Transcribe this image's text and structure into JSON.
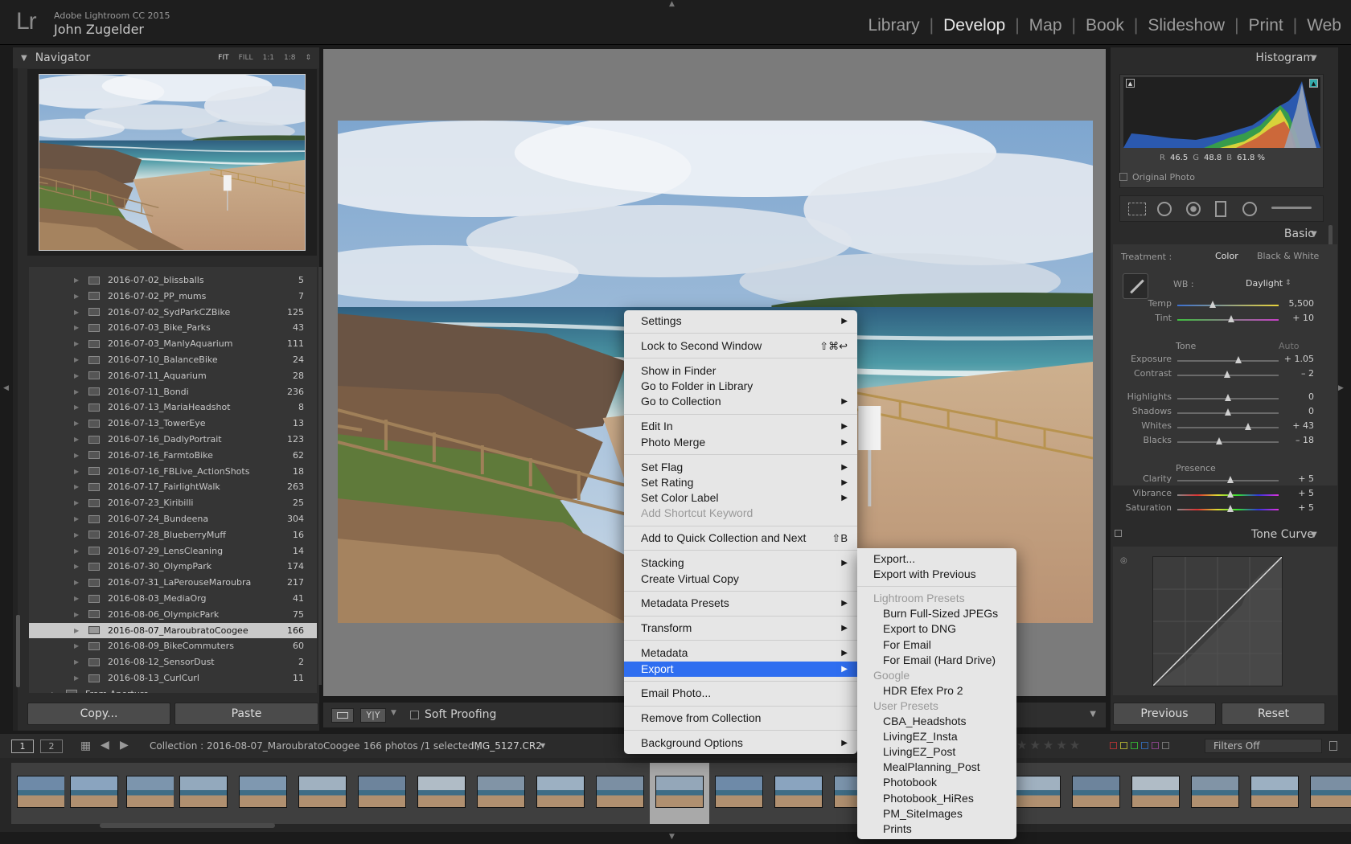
{
  "app": {
    "logo": "Lr",
    "name": "Adobe Lightroom CC 2015",
    "user": "John Zugelder"
  },
  "modules": [
    {
      "label": "Library",
      "active": false
    },
    {
      "label": "Develop",
      "active": true
    },
    {
      "label": "Map",
      "active": false
    },
    {
      "label": "Book",
      "active": false
    },
    {
      "label": "Slideshow",
      "active": false
    },
    {
      "label": "Print",
      "active": false
    },
    {
      "label": "Web",
      "active": false
    }
  ],
  "navigator": {
    "title": "Navigator",
    "zoom": [
      "FIT",
      "FILL",
      "1:1",
      "1:8"
    ]
  },
  "folders": [
    {
      "name": "2016-07-02_blissballs",
      "count": "5"
    },
    {
      "name": "2016-07-02_PP_mums",
      "count": "7"
    },
    {
      "name": "2016-07-02_SydParkCZBike",
      "count": "125"
    },
    {
      "name": "2016-07-03_Bike_Parks",
      "count": "43"
    },
    {
      "name": "2016-07-03_ManlyAquarium",
      "count": "111"
    },
    {
      "name": "2016-07-10_BalanceBike",
      "count": "24"
    },
    {
      "name": "2016-07-11_Aquarium",
      "count": "28"
    },
    {
      "name": "2016-07-11_Bondi",
      "count": "236"
    },
    {
      "name": "2016-07-13_MariaHeadshot",
      "count": "8"
    },
    {
      "name": "2016-07-13_TowerEye",
      "count": "13"
    },
    {
      "name": "2016-07-16_DadlyPortrait",
      "count": "123"
    },
    {
      "name": "2016-07-16_FarmtoBike",
      "count": "62"
    },
    {
      "name": "2016-07-16_FBLive_ActionShots",
      "count": "18"
    },
    {
      "name": "2016-07-17_FairlightWalk",
      "count": "263"
    },
    {
      "name": "2016-07-23_Kiribilli",
      "count": "25"
    },
    {
      "name": "2016-07-24_Bundeena",
      "count": "304"
    },
    {
      "name": "2016-07-28_BlueberryMuff",
      "count": "16"
    },
    {
      "name": "2016-07-29_LensCleaning",
      "count": "14"
    },
    {
      "name": "2016-07-30_OlympPark",
      "count": "174"
    },
    {
      "name": "2016-07-31_LaPerouseMaroubra",
      "count": "217"
    },
    {
      "name": "2016-08-03_MediaOrg",
      "count": "41"
    },
    {
      "name": "2016-08-06_OlympicPark",
      "count": "75"
    },
    {
      "name": "2016-08-07_MaroubratoCoogee",
      "count": "166",
      "selected": true
    },
    {
      "name": "2016-08-09_BikeCommuters",
      "count": "60"
    },
    {
      "name": "2016-08-12_SensorDust",
      "count": "2"
    },
    {
      "name": "2016-08-13_CurlCurl",
      "count": "11"
    }
  ],
  "folders_extra": "From Aperture",
  "left_buttons": {
    "copy": "Copy...",
    "paste": "Paste"
  },
  "toolbar": {
    "soft_proofing": "Soft Proofing",
    "yy": "Y|Y"
  },
  "right": {
    "histogram": "Histogram",
    "rgb": {
      "r_label": "R",
      "r": "46.5",
      "g_label": "G",
      "g": "48.8",
      "b_label": "B",
      "b": "61.8 %"
    },
    "original_photo": "Original Photo",
    "basic": "Basic",
    "treatment_label": "Treatment :",
    "treatment_color": "Color",
    "treatment_bw": "Black & White",
    "wb_label": "WB :",
    "wb_value": "Daylight",
    "tone": "Tone",
    "auto": "Auto",
    "presence": "Presence",
    "tone_curve": "Tone Curve",
    "previous": "Previous",
    "reset": "Reset",
    "sliders": [
      {
        "label": "Temp",
        "value": "5,500",
        "pos": 0.35,
        "color": "temp"
      },
      {
        "label": "Tint",
        "value": "+ 10",
        "pos": 0.53,
        "color": "tint"
      },
      {
        "label": "Exposure",
        "value": "+ 1.05",
        "pos": 0.6,
        "color": "gray"
      },
      {
        "label": "Contrast",
        "value": "– 2",
        "pos": 0.49,
        "color": "gray"
      },
      {
        "label": "Highlights",
        "value": "0",
        "pos": 0.5,
        "color": "gray"
      },
      {
        "label": "Shadows",
        "value": "0",
        "pos": 0.5,
        "color": "gray"
      },
      {
        "label": "Whites",
        "value": "+ 43",
        "pos": 0.7,
        "color": "gray"
      },
      {
        "label": "Blacks",
        "value": "– 18",
        "pos": 0.41,
        "color": "gray"
      },
      {
        "label": "Clarity",
        "value": "+ 5",
        "pos": 0.52,
        "color": "gray"
      },
      {
        "label": "Vibrance",
        "value": "+ 5",
        "pos": 0.52,
        "color": "sat"
      },
      {
        "label": "Saturation",
        "value": "+ 5",
        "pos": 0.52,
        "color": "sat"
      }
    ]
  },
  "filmstrip": {
    "page1": "1",
    "page2": "2",
    "collection": "Collection : 2016-08-07_MaroubratoCoogee",
    "count": "166 photos /1 selected /",
    "file": "IMG_5127.CR2",
    "filter": "Filters Off"
  },
  "context_menu": {
    "items": [
      {
        "label": "Settings",
        "arrow": true
      },
      {
        "sep": true
      },
      {
        "label": "Lock to Second Window",
        "shortcut": "⇧⌘↩"
      },
      {
        "sep": true
      },
      {
        "label": "Show in Finder"
      },
      {
        "label": "Go to Folder in Library"
      },
      {
        "label": "Go to Collection",
        "arrow": true
      },
      {
        "sep": true
      },
      {
        "label": "Edit In",
        "arrow": true
      },
      {
        "label": "Photo Merge",
        "arrow": true
      },
      {
        "sep": true
      },
      {
        "label": "Set Flag",
        "arrow": true
      },
      {
        "label": "Set Rating",
        "arrow": true
      },
      {
        "label": "Set Color Label",
        "arrow": true
      },
      {
        "label": "Add Shortcut Keyword",
        "disabled": true
      },
      {
        "sep": true
      },
      {
        "label": "Add to Quick Collection and Next",
        "shortcut": "⇧B"
      },
      {
        "sep": true
      },
      {
        "label": "Stacking",
        "arrow": true
      },
      {
        "label": "Create Virtual Copy"
      },
      {
        "sep": true
      },
      {
        "label": "Metadata Presets",
        "arrow": true
      },
      {
        "sep": true
      },
      {
        "label": "Transform",
        "arrow": true
      },
      {
        "sep": true
      },
      {
        "label": "Metadata",
        "arrow": true
      },
      {
        "label": "Export",
        "arrow": true,
        "highlighted": true
      },
      {
        "sep": true
      },
      {
        "label": "Email Photo..."
      },
      {
        "sep": true
      },
      {
        "label": "Remove from Collection"
      },
      {
        "sep": true
      },
      {
        "label": "Background Options",
        "arrow": true
      }
    ],
    "export_submenu": [
      {
        "label": "Export..."
      },
      {
        "label": "Export with Previous"
      },
      {
        "sep": true
      },
      {
        "label": "Lightroom Presets",
        "disabled": true
      },
      {
        "label": "Burn Full-Sized JPEGs",
        "indent": true
      },
      {
        "label": "Export to DNG",
        "indent": true
      },
      {
        "label": "For Email",
        "indent": true
      },
      {
        "label": "For Email (Hard Drive)",
        "indent": true
      },
      {
        "label": "Google",
        "disabled": true
      },
      {
        "label": "HDR Efex Pro 2",
        "indent": true
      },
      {
        "label": "User Presets",
        "disabled": true
      },
      {
        "label": "CBA_Headshots",
        "indent": true
      },
      {
        "label": "LivingEZ_Insta",
        "indent": true
      },
      {
        "label": "LivingEZ_Post",
        "indent": true
      },
      {
        "label": "MealPlanning_Post",
        "indent": true
      },
      {
        "label": "Photobook",
        "indent": true
      },
      {
        "label": "Photobook_HiRes",
        "indent": true
      },
      {
        "label": "PM_SiteImages",
        "indent": true
      },
      {
        "label": "Prints",
        "indent": true
      }
    ]
  }
}
